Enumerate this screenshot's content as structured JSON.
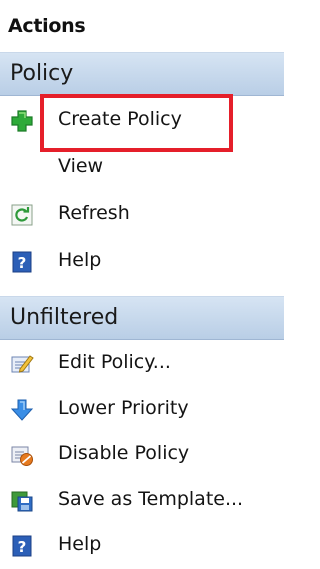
{
  "actions": {
    "title": "Actions"
  },
  "sections": {
    "policy": {
      "title": "Policy",
      "items": [
        {
          "label": "Create Policy",
          "icon": "green-plus-icon"
        },
        {
          "label": "View",
          "icon": "none"
        },
        {
          "label": "Refresh",
          "icon": "refresh-icon"
        },
        {
          "label": "Help",
          "icon": "help-icon"
        }
      ]
    },
    "unfiltered": {
      "title": "Unfiltered",
      "items": [
        {
          "label": "Edit Policy...",
          "icon": "edit-icon"
        },
        {
          "label": "Lower Priority",
          "icon": "down-arrow-icon"
        },
        {
          "label": "Disable Policy",
          "icon": "disable-icon"
        },
        {
          "label": "Save as Template...",
          "icon": "save-template-icon"
        },
        {
          "label": "Help",
          "icon": "help-icon"
        }
      ]
    }
  },
  "colors": {
    "section_gradient_top": "#d6e4f3",
    "section_gradient_bottom": "#b9cee6",
    "highlight_red": "#e51f2a",
    "help_blue": "#2c5fb7",
    "plus_green": "#2eaa39"
  }
}
